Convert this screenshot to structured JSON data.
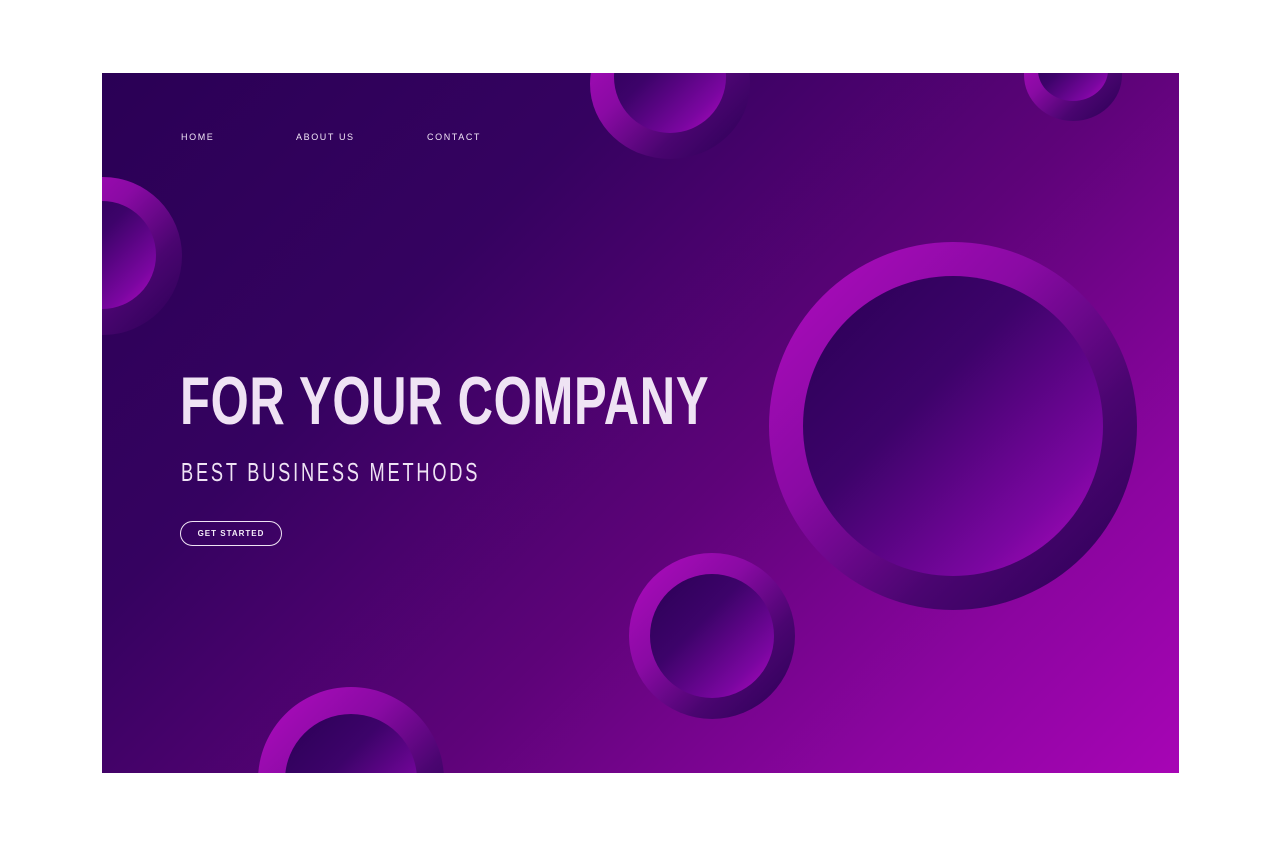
{
  "nav": {
    "items": [
      {
        "label": "HOME"
      },
      {
        "label": "ABOUT US"
      },
      {
        "label": "CONTACT"
      }
    ]
  },
  "hero": {
    "title": "FOR YOUR COMPANY",
    "subtitle": "BEST BUSINESS METHODS",
    "cta_label": "GET STARTED"
  },
  "colors": {
    "background_dark": "#2a0055",
    "background_light": "#a705b5",
    "ring_highlight": "#b00cbf",
    "text": "#efe3f4"
  }
}
